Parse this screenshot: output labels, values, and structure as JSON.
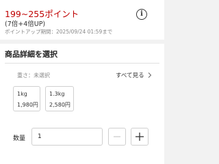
{
  "points": {
    "range": "199~255ポイント",
    "multiplier": "(7倍+4倍UP)",
    "deadline": "ポイントアップ期間：2025/09/24 01:59まで"
  },
  "product_details": {
    "title": "商品詳細を選択",
    "spec_label": "重さ：未選択",
    "see_all": "すべて見る",
    "options": [
      {
        "name": "1kg",
        "price": "1,980円"
      },
      {
        "name": "1.3kg",
        "price": "2,580円"
      }
    ],
    "quantity_label": "数量",
    "quantity_value": "1"
  },
  "colors": {
    "point_red": "#bf0000"
  },
  "icons": {
    "info": "info-icon",
    "chevron": "chevron-right-icon",
    "minus": "minus-icon",
    "plus": "plus-icon"
  }
}
